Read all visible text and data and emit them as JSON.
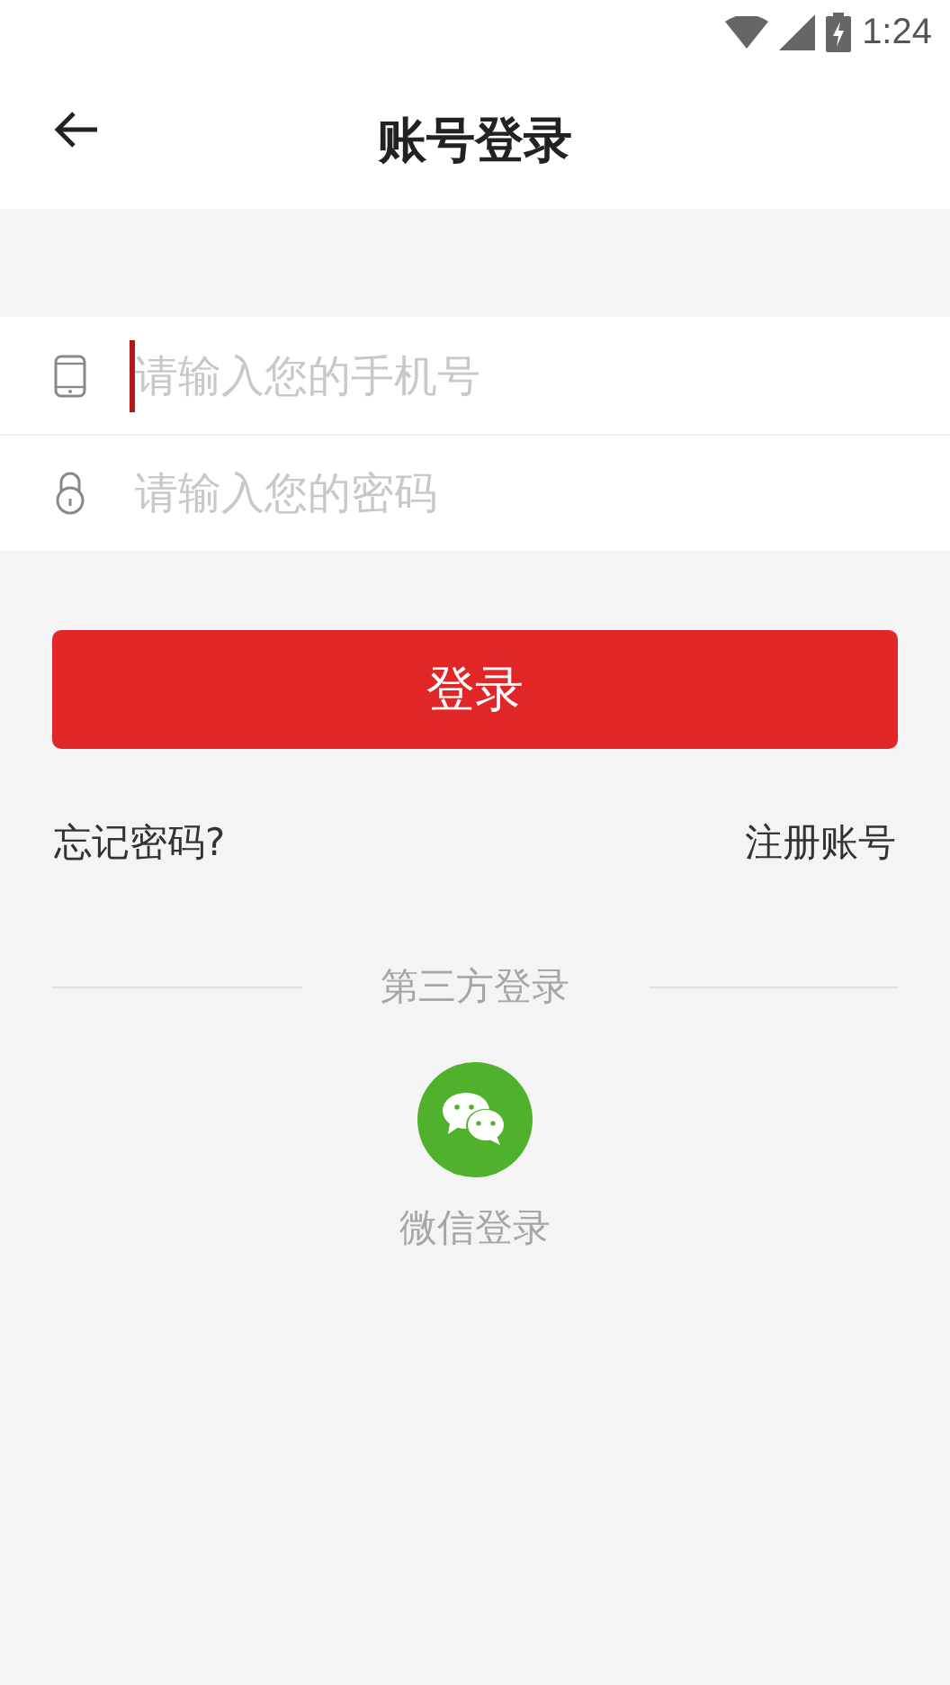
{
  "status_bar": {
    "time": "1:24"
  },
  "header": {
    "title": "账号登录"
  },
  "fields": [
    {
      "kind": "phone",
      "placeholder": "请输入您的手机号",
      "focused": true
    },
    {
      "kind": "password",
      "placeholder": "请输入您的密码",
      "focused": false
    }
  ],
  "login_button": "登录",
  "links": {
    "forgot": "忘记密码?",
    "register": "注册账号"
  },
  "third_party": {
    "heading": "第三方登录",
    "wechat_label": "微信登录"
  }
}
